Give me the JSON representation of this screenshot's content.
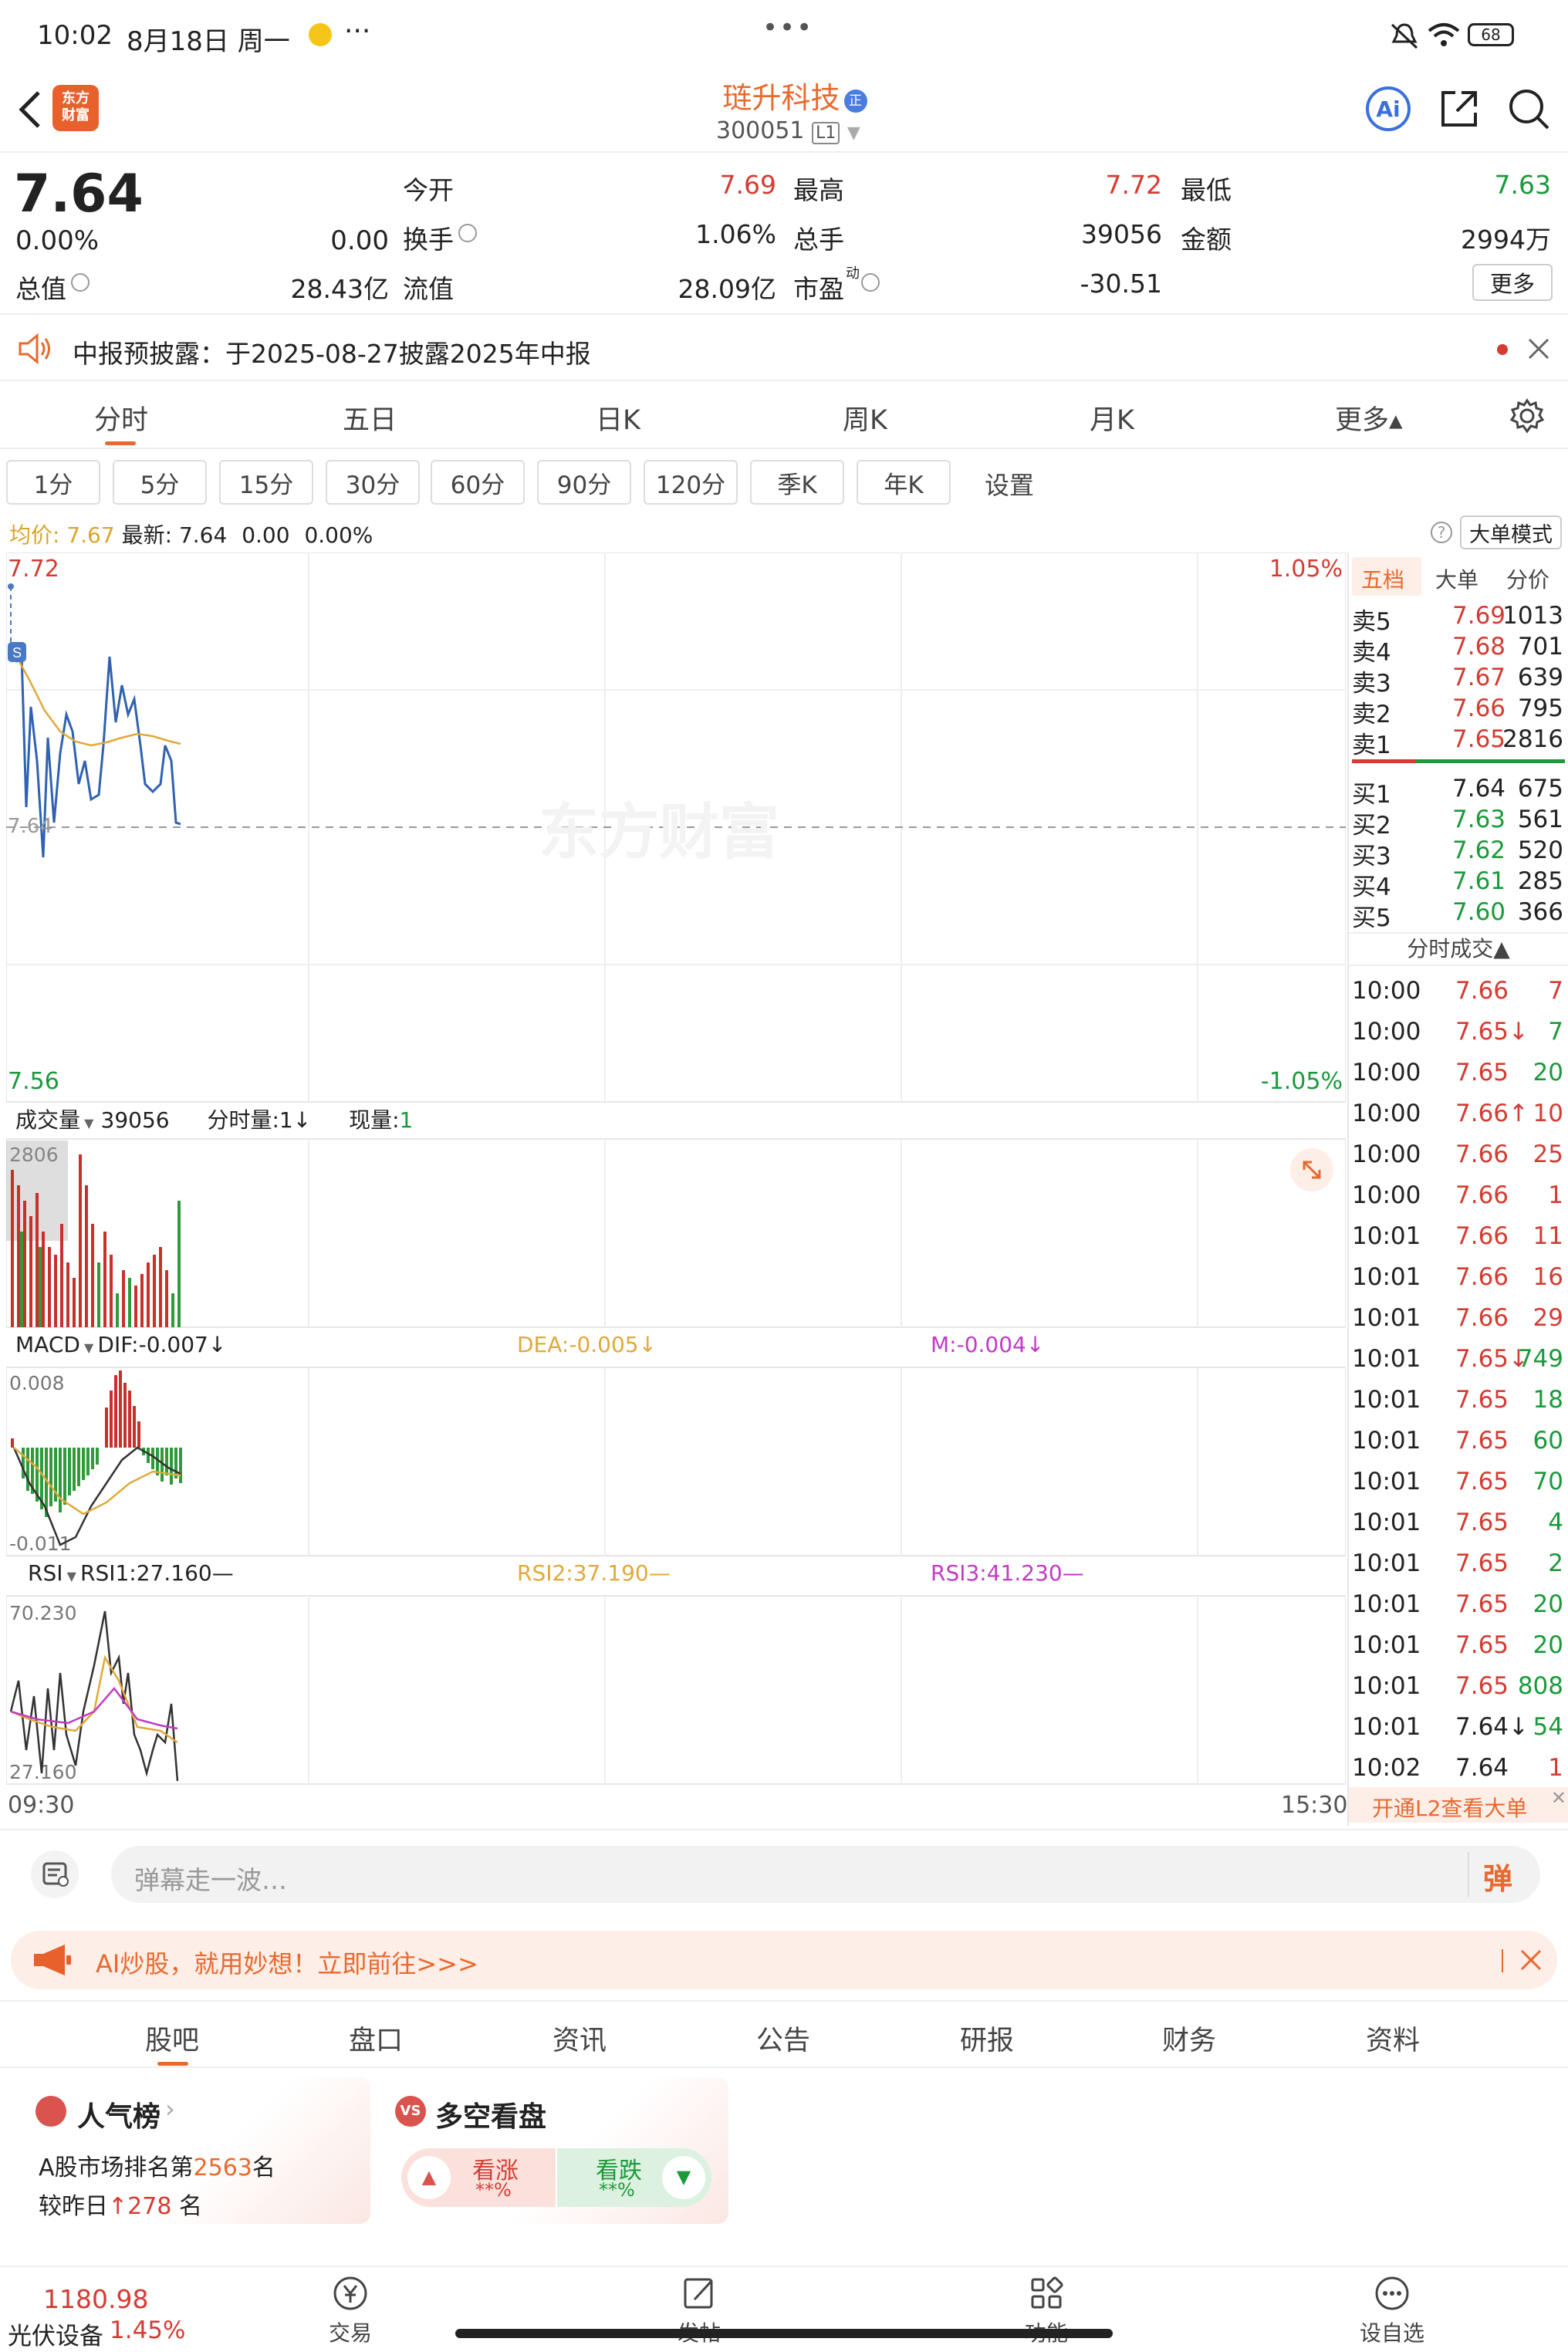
{
  "status": {
    "time": "10:02",
    "date": "8月18日 周一",
    "more": "···",
    "dots": "•••",
    "battery": "68"
  },
  "header": {
    "stock_name": "琏升科技",
    "code": "300051",
    "level": "L1",
    "ai": "Ai",
    "logo_line1": "东方",
    "logo_line2": "财富",
    "ri_badge": "正"
  },
  "quote": {
    "price": "7.64",
    "change_pct": "0.00%",
    "change_abs": "0.00",
    "open_label": "今开",
    "open": "7.69",
    "high_label": "最高",
    "high": "7.72",
    "low_label": "最低",
    "low": "7.63",
    "turnover_label": "换手",
    "turnover": "1.06%",
    "volume_label": "总手",
    "volume": "39056",
    "amount_label": "金额",
    "amount": "2994万",
    "mktcap_label": "总值",
    "mktcap": "28.43亿",
    "float_label": "流值",
    "float": "28.09亿",
    "pe_label": "市盈",
    "pe_sup": "动",
    "pe": "-30.51",
    "more": "更多"
  },
  "notice": {
    "text": "中报预披露：于2025-08-27披露2025年中报"
  },
  "period_tabs": [
    "分时",
    "五日",
    "日K",
    "周K",
    "月K",
    "更多▴"
  ],
  "interval_chips": [
    "1分",
    "5分",
    "15分",
    "30分",
    "60分",
    "90分",
    "120分",
    "季K",
    "年K"
  ],
  "settings_label": "设置",
  "chart_info": {
    "avg_label": "均价:",
    "avg": "7.67",
    "last_label": "最新:",
    "last": "7.64",
    "chg": "0.00",
    "chg_pct": "0.00%",
    "big_mode": "大单模式"
  },
  "price_chart": {
    "top": "7.72",
    "bottom": "7.56",
    "mid": "7.64",
    "top_pct": "1.05%",
    "bottom_pct": "-1.05%",
    "watermark": "东方财富"
  },
  "vol_panel": {
    "label": "成交量",
    "value": "39056",
    "min_vol": "分时量:1↓",
    "now_vol_label": "现量:",
    "now_vol": "1",
    "max": "2806"
  },
  "macd_panel": {
    "label": "MACD",
    "dif": "DIF:-0.007↓",
    "dea": "DEA:-0.005↓",
    "m": "M:-0.004↓",
    "max": "0.008",
    "min": "-0.011"
  },
  "rsi_panel": {
    "label": "RSI",
    "rsi1": "RSI1:27.160—",
    "rsi2": "RSI2:37.190—",
    "rsi3": "RSI3:41.230—",
    "max": "70.230",
    "min": "27.160"
  },
  "time_axis": {
    "start": "09:30",
    "end": "15:30"
  },
  "orderbook": {
    "tabs": [
      "五档",
      "大单",
      "分价"
    ],
    "asks": [
      {
        "l": "卖5",
        "p": "7.69",
        "v": "1013"
      },
      {
        "l": "卖4",
        "p": "7.68",
        "v": "701"
      },
      {
        "l": "卖3",
        "p": "7.67",
        "v": "639"
      },
      {
        "l": "卖2",
        "p": "7.66",
        "v": "795"
      },
      {
        "l": "卖1",
        "p": "7.65",
        "v": "2816"
      }
    ],
    "bids": [
      {
        "l": "买1",
        "p": "7.64",
        "v": "675"
      },
      {
        "l": "买2",
        "p": "7.63",
        "v": "561"
      },
      {
        "l": "买3",
        "p": "7.62",
        "v": "520"
      },
      {
        "l": "买4",
        "p": "7.61",
        "v": "285"
      },
      {
        "l": "买5",
        "p": "7.60",
        "v": "366"
      }
    ],
    "ticks_title": "分时成交▲",
    "ticks": [
      {
        "t": "10:00",
        "p": "7.66",
        "v": "7"
      },
      {
        "t": "10:00",
        "p": "7.65↓",
        "v": "7"
      },
      {
        "t": "10:00",
        "p": "7.65",
        "v": "20"
      },
      {
        "t": "10:00",
        "p": "7.66↑",
        "v": "10"
      },
      {
        "t": "10:00",
        "p": "7.66",
        "v": "25"
      },
      {
        "t": "10:00",
        "p": "7.66",
        "v": "1"
      },
      {
        "t": "10:01",
        "p": "7.66",
        "v": "11"
      },
      {
        "t": "10:01",
        "p": "7.66",
        "v": "16"
      },
      {
        "t": "10:01",
        "p": "7.66",
        "v": "29"
      },
      {
        "t": "10:01",
        "p": "7.65↓",
        "v": "749"
      },
      {
        "t": "10:01",
        "p": "7.65",
        "v": "18"
      },
      {
        "t": "10:01",
        "p": "7.65",
        "v": "60"
      },
      {
        "t": "10:01",
        "p": "7.65",
        "v": "70"
      },
      {
        "t": "10:01",
        "p": "7.65",
        "v": "4"
      },
      {
        "t": "10:01",
        "p": "7.65",
        "v": "2"
      },
      {
        "t": "10:01",
        "p": "7.65",
        "v": "20"
      },
      {
        "t": "10:01",
        "p": "7.65",
        "v": "20"
      },
      {
        "t": "10:01",
        "p": "7.65",
        "v": "808"
      },
      {
        "t": "10:01",
        "p": "7.64↓",
        "v": "54"
      },
      {
        "t": "10:02",
        "p": "7.64",
        "v": "1"
      }
    ],
    "l2_promo": "开通L2查看大单"
  },
  "danmu": {
    "placeholder": "弹幕走一波…",
    "btn": "弹"
  },
  "ai_banner": {
    "text": "AI炒股，就用妙想！立即前往>>>"
  },
  "bottom_tabs": [
    "股吧",
    "盘口",
    "资讯",
    "公告",
    "研报",
    "财务",
    "资料"
  ],
  "cards": {
    "popularity": {
      "title": "人气榜",
      "line1_pre": "A股市场排名第",
      "rank": "2563",
      "line1_post": "名",
      "line2_pre": "较昨日",
      "change": "278",
      "line2_post": "名"
    },
    "sentiment": {
      "title": "多空看盘",
      "up": "看涨",
      "up_pct": "**%",
      "down": "看跌",
      "down_pct": "**%"
    }
  },
  "footer": {
    "index_val": "1180.98",
    "index_name": "光伏设备",
    "index_pct": "1.45%",
    "items": [
      "交易",
      "发帖",
      "功能",
      "设自选"
    ]
  }
}
